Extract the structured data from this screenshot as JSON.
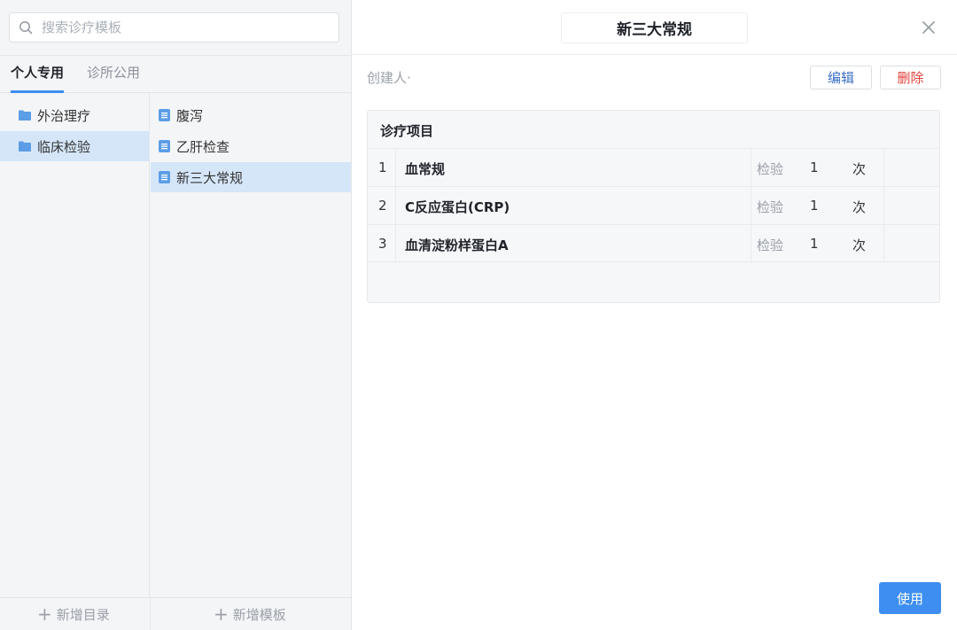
{
  "search": {
    "placeholder": "搜索诊疗模板"
  },
  "tabs": [
    {
      "label": "个人专用",
      "active": true
    },
    {
      "label": "诊所公用",
      "active": false
    }
  ],
  "folders": [
    {
      "label": "外治理疗",
      "selected": false,
      "icon": "folder-icon"
    },
    {
      "label": "临床检验",
      "selected": true,
      "icon": "folder-icon"
    }
  ],
  "templates": [
    {
      "label": "腹泻",
      "selected": false,
      "icon": "document-icon"
    },
    {
      "label": "乙肝检查",
      "selected": false,
      "icon": "document-icon"
    },
    {
      "label": "新三大常规",
      "selected": true,
      "icon": "document-icon"
    }
  ],
  "footer": {
    "add_folder": "新增目录",
    "add_template": "新增模板"
  },
  "detail": {
    "title": "新三大常规",
    "creator_label": "创建人·",
    "edit_label": "编辑",
    "delete_label": "删除",
    "section_title": "诊疗项目",
    "items": [
      {
        "index": "1",
        "name": "血常规",
        "category": "检验",
        "qty": "1",
        "unit": "次"
      },
      {
        "index": "2",
        "name": "C反应蛋白(CRP)",
        "category": "检验",
        "qty": "1",
        "unit": "次"
      },
      {
        "index": "3",
        "name": "血清淀粉样蛋白A",
        "category": "检验",
        "qty": "1",
        "unit": "次"
      }
    ],
    "use_label": "使用"
  },
  "colors": {
    "accent": "#3d8ef0",
    "selected_bg": "#d5e6f9",
    "danger": "#e0403a",
    "edit": "#3b6fc4"
  }
}
